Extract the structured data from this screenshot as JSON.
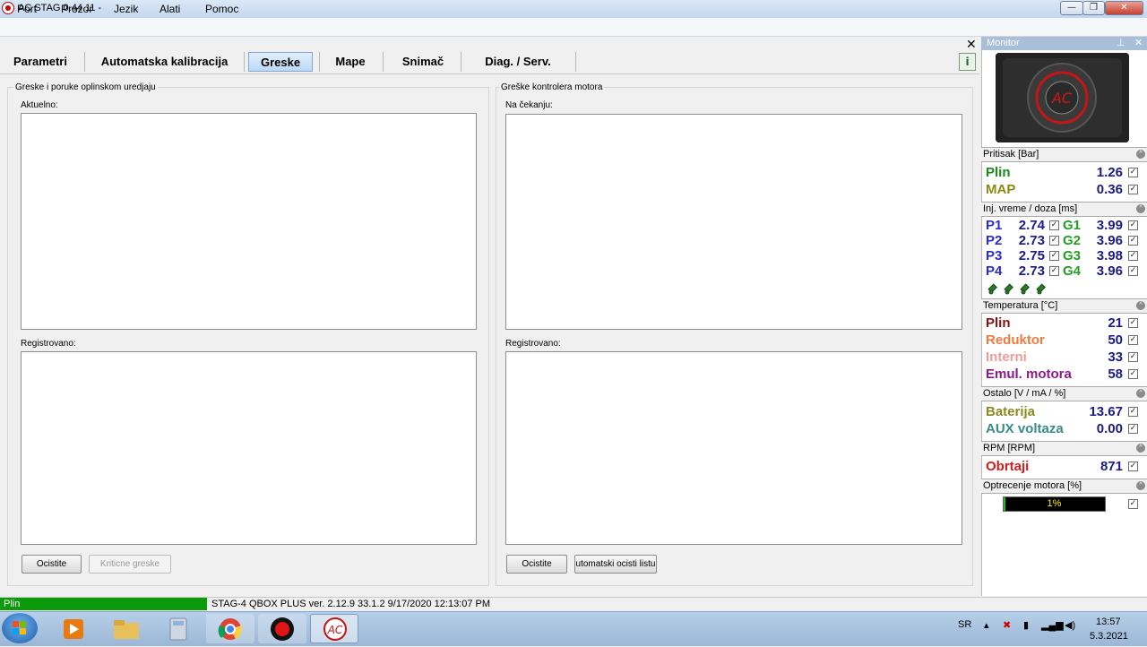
{
  "window": {
    "title": "AC STAG 0.44.11 -",
    "minimize_label": "—",
    "maximize_label": "❐",
    "close_label": "✕"
  },
  "menu": [
    "Port",
    "Prozor",
    "Jezik",
    "Alati",
    "Pomoc"
  ],
  "panel_close": "✕",
  "tabs": [
    "Parametri",
    "Automatska kalibracija",
    "Greske",
    "Mape",
    "Snimač",
    "Diag. / Serv."
  ],
  "active_tab": "Greske",
  "left_group": {
    "title": "Greske i poruke oplinskom uredjaju",
    "current_label": "Aktuelno:",
    "registered_label": "Registrovano:",
    "btn_clear": "Ocistite",
    "btn_critical": "Kriticne greske"
  },
  "right_group": {
    "title": "Greške kontrolera motora",
    "pending_label": "Na čekanju:",
    "registered_label": "Registrovano:",
    "btn_clear": "Ocistite",
    "btn_auto": "utomatski ocisti listu"
  },
  "status": {
    "mode": "Plin",
    "info": "STAG-4 QBOX PLUS  ver. 2.12.9  33.1.2  9/17/2020 12:13:07 PM"
  },
  "monitor": {
    "title": "Monitor",
    "pin_icon": "pin-icon",
    "pressure": {
      "header": "Pritisak [Bar]",
      "rows": [
        {
          "label": "Plin",
          "value": "1.26",
          "color": "#1a8a1a"
        },
        {
          "label": "MAP",
          "value": "0.36",
          "color": "#8a8a10"
        }
      ]
    },
    "injection": {
      "header": "Inj. vreme / doza [ms]",
      "petrol": [
        {
          "label": "P1",
          "value": "2.74"
        },
        {
          "label": "P2",
          "value": "2.73"
        },
        {
          "label": "P3",
          "value": "2.75"
        },
        {
          "label": "P4",
          "value": "2.73"
        }
      ],
      "gas": [
        {
          "label": "G1",
          "value": "3.99"
        },
        {
          "label": "G2",
          "value": "3.96"
        },
        {
          "label": "G3",
          "value": "3.98"
        },
        {
          "label": "G4",
          "value": "3.96"
        }
      ],
      "petrol_color": "#2a2ad6",
      "gas_color": "#22a022"
    },
    "temperature": {
      "header": "Temperatura [°C]",
      "rows": [
        {
          "label": "Plin",
          "value": "21",
          "color": "#8a1010"
        },
        {
          "label": "Reduktor",
          "value": "50",
          "color": "#f07a40"
        },
        {
          "label": "Interni",
          "value": "33",
          "color": "#f09a9a"
        },
        {
          "label": "Emul. motora",
          "value": "58",
          "color": "#8a1a8a"
        }
      ]
    },
    "other": {
      "header": "Ostalo [V / mA / %]",
      "rows": [
        {
          "label": "Baterija",
          "value": "13.67",
          "color": "#8a8a20"
        },
        {
          "label": "AUX voltaza",
          "value": "0.00",
          "color": "#3a8a8a"
        }
      ]
    },
    "rpm": {
      "header": "RPM [RPM]",
      "rows": [
        {
          "label": "Obrtaji",
          "value": "871",
          "color": "#d61a1a"
        }
      ]
    },
    "load": {
      "header": "Optrecenje motora [%]",
      "value_text": "1%",
      "value": 1
    }
  },
  "taskbar": {
    "lang": "SR",
    "time": "13:57",
    "date": "5.3.2021"
  }
}
